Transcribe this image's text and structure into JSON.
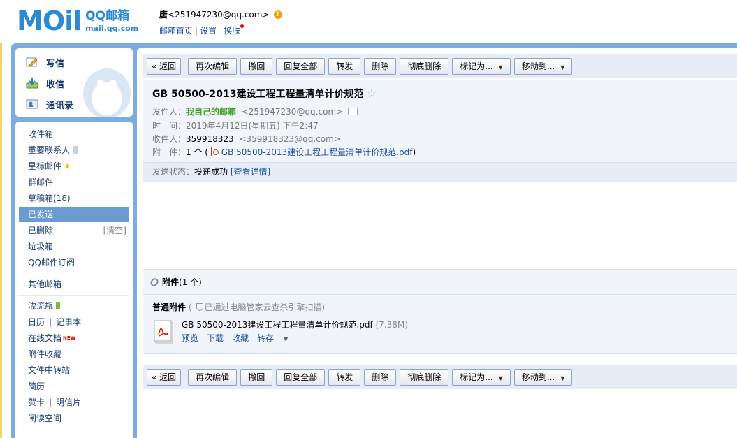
{
  "header": {
    "logo_mark": "MOil",
    "logo_title": "QQ邮箱",
    "logo_url": "mail.qq.com",
    "user_name": "唐",
    "user_email": "<251947230@qq.com>",
    "links": [
      "邮箱首页",
      "设置",
      "换肤"
    ]
  },
  "sidebar": {
    "actions": [
      {
        "label": "写信",
        "icon": "pencil-icon"
      },
      {
        "label": "收信",
        "icon": "inbox-download-icon"
      },
      {
        "label": "通讯录",
        "icon": "contacts-card-icon"
      }
    ],
    "folders": {
      "inbox": "收件箱",
      "vip": "重要联系人",
      "starred": "星标邮件",
      "group": "群邮件",
      "drafts": "草稿箱(18)",
      "sent": "已发送",
      "deleted": "已删除",
      "deleted_clear": "[清空]",
      "spam": "垃圾箱",
      "subscriptions": "QQ邮件订阅",
      "other_mail": "其他邮箱",
      "bottle": "漂流瓶",
      "calendar": "日历",
      "notes": "记事本",
      "docs": "在线文档",
      "docs_badge": "NEW",
      "attach_fav": "附件收藏",
      "file_transfer": "文件中转站",
      "resume": "简历",
      "greeting_card": "贺卡",
      "postcard": "明信片",
      "reading": "阅读空间"
    }
  },
  "toolbar": {
    "back": "« 返回",
    "reedit": "再次编辑",
    "recall": "撤回",
    "reply_all": "回复全部",
    "forward": "转发",
    "delete": "删除",
    "delete_forever": "彻底删除",
    "mark_as": "标记为...",
    "move_to": "移动到..."
  },
  "mail": {
    "subject": "GB 50500-2013建设工程工程量清单计价规范",
    "from_label": "发件人：",
    "from_name": "我自己的邮箱",
    "from_email": "<251947230@qq.com>",
    "time_label": "时　间：",
    "time_value": "2019年4月12日(星期五) 下午2:47",
    "to_label": "收件人：",
    "to_name": "359918323",
    "to_email": "<359918323@qq.com>",
    "attach_label": "附　件：",
    "attach_count": "1 个 (",
    "attach_file": "GB 50500-2013建设工程工程量清单计价规范.pdf",
    "attach_close": ")",
    "status_label": "发送状态：",
    "status_value": "投递成功",
    "status_link": "[查看详情]"
  },
  "attachments": {
    "title_bold": "附件",
    "title_count": "(1 个)",
    "section_label": "普通附件",
    "scan_note": "已通过电脑管家云查杀引擎扫描)",
    "scan_open": "(",
    "file_name": "GB 50500-2013建设工程工程量清单计价规范.pdf",
    "file_size": "(7.38M)",
    "actions": {
      "preview": "预览",
      "download": "下载",
      "collect": "收藏",
      "save_to": "转存"
    }
  },
  "colors": {
    "frame": "#7aaee0",
    "active_nav": "#6c9bd1",
    "link": "#1e4fa1",
    "green": "#48a035"
  }
}
